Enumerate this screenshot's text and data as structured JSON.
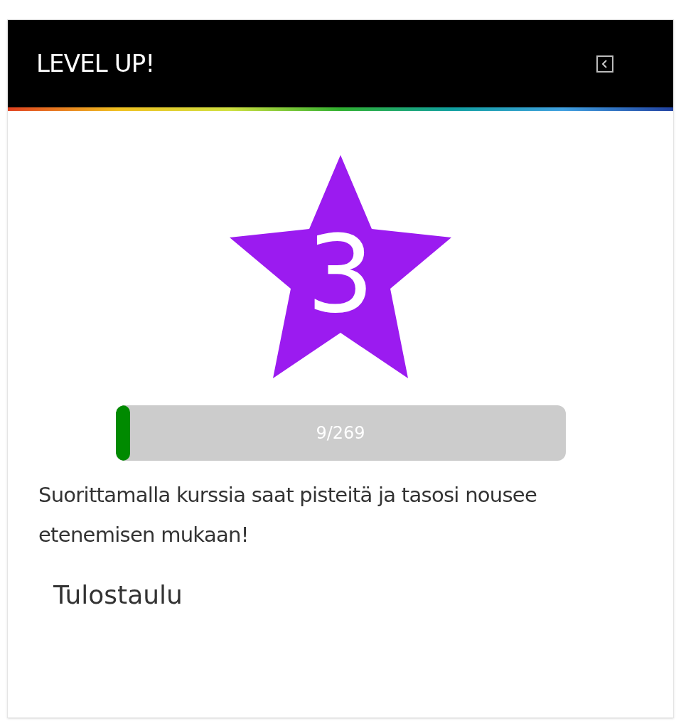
{
  "header": {
    "title": "LEVEL UP!"
  },
  "level_badge": {
    "text": "3"
  },
  "progress": {
    "level": 0.033,
    "reading": "9/269"
  },
  "description": "Suorittamalla kurssia saat pisteitä ja tasosi nousee etenemisen mukaan!",
  "leaderboard_link": "Tulostaulu"
}
